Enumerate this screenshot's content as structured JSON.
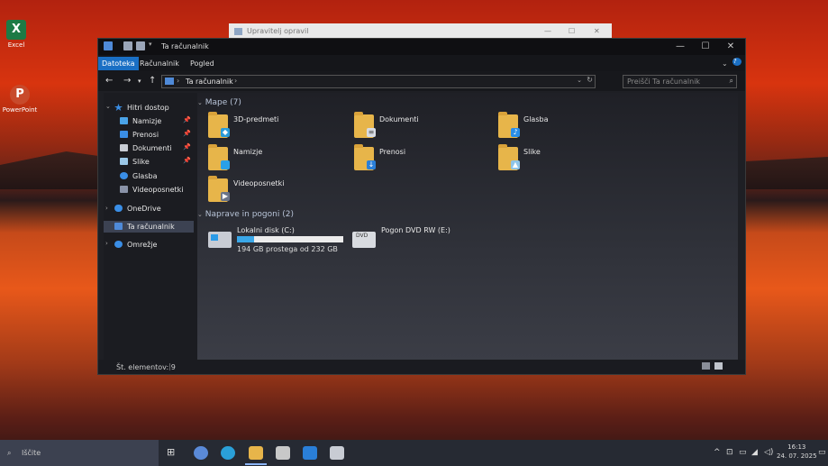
{
  "desktop": {
    "icons": [
      {
        "label": "Excel",
        "icon": "excel-icon",
        "color": "#1d7a45"
      },
      {
        "label": "PowerPoint",
        "icon": "powerpoint-icon",
        "color": "#c84a2b"
      }
    ]
  },
  "background_window": {
    "title": "Upravitelj opravil"
  },
  "window": {
    "title": "Ta računalnik",
    "ribbon_tabs": [
      "Datoteka",
      "Računalnik",
      "Pogled"
    ],
    "address": {
      "path": "Ta računalnik",
      "search_placeholder": "Preišči Ta računalnik"
    },
    "sidebar": {
      "quick_access": "Hitri dostop",
      "quick_items": [
        {
          "label": "Namizje",
          "icon": "desktop-icon",
          "pinned": true
        },
        {
          "label": "Prenosi",
          "icon": "download-icon",
          "pinned": true
        },
        {
          "label": "Dokumenti",
          "icon": "documents-icon",
          "pinned": true
        },
        {
          "label": "Slike",
          "icon": "pictures-icon",
          "pinned": true
        },
        {
          "label": "Glasba",
          "icon": "music-icon",
          "pinned": false
        },
        {
          "label": "Videoposnetki",
          "icon": "videos-icon",
          "pinned": false
        }
      ],
      "onedrive": "OneDrive",
      "this_pc": "Ta računalnik",
      "network": "Omrežje"
    },
    "folders_header": "Mape (7)",
    "folders": [
      {
        "label": "3D-predmeti",
        "icon": "3d-objects-icon"
      },
      {
        "label": "Dokumenti",
        "icon": "documents-icon"
      },
      {
        "label": "Glasba",
        "icon": "music-icon"
      },
      {
        "label": "Namizje",
        "icon": "desktop-icon"
      },
      {
        "label": "Prenosi",
        "icon": "download-icon"
      },
      {
        "label": "Slike",
        "icon": "pictures-icon"
      },
      {
        "label": "Videoposnetki",
        "icon": "videos-icon"
      }
    ],
    "drives_header": "Naprave in pogoni (2)",
    "drives": [
      {
        "label": "Lokalni disk (C:)",
        "info": "194 GB prostega od 232 GB",
        "used_fraction": 0.16,
        "icon": "local-disk-icon"
      },
      {
        "label": "Pogon DVD RW (E:)",
        "info": "",
        "icon": "dvd-drive-icon"
      }
    ],
    "status": "Št. elementov: 9"
  },
  "taskbar": {
    "search_placeholder": "Iščite",
    "time": "16:13",
    "date": "24. 07. 2025"
  },
  "colors": {
    "accent": "#1a6fc4",
    "folder": "#e7b54a",
    "disk_fill": "#3aa7e8"
  }
}
